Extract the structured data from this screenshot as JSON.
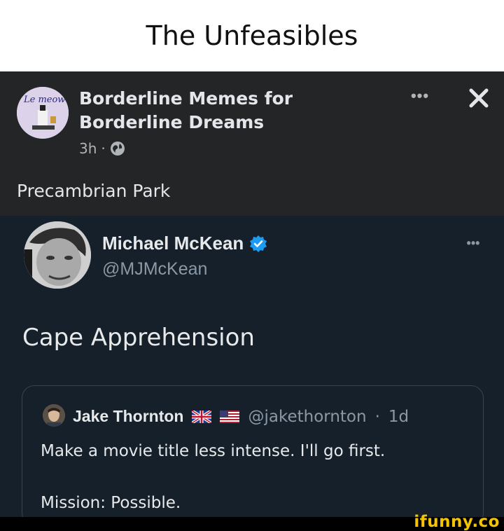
{
  "caption": "The Unfeasibles",
  "facebook_post": {
    "avatar_text": "Le meow",
    "group_name": "Borderline Memes for Borderline Dreams",
    "time": "3h",
    "meta_separator": "·",
    "more_icon": "more-horizontal-icon",
    "close_icon": "close-icon",
    "text": "Precambrian Park"
  },
  "tweet": {
    "author_name": "Michael McKean",
    "handle": "@MJMcKean",
    "verified": true,
    "text": "Cape Apprehension",
    "quote": {
      "author_name": "Jake Thornton",
      "flags": [
        "uk-flag-icon",
        "us-flag-icon"
      ],
      "handle": "@jakethornton",
      "separator": "·",
      "age": "1d",
      "line1": "Make a movie title less intense. I'll go first.",
      "line2": "Mission: Possible."
    }
  },
  "watermark": "ifunny.co",
  "colors": {
    "fb_background": "#242526",
    "tweet_background": "#15202b",
    "verified_blue": "#1d9bf0",
    "watermark_yellow": "#f5c400"
  }
}
